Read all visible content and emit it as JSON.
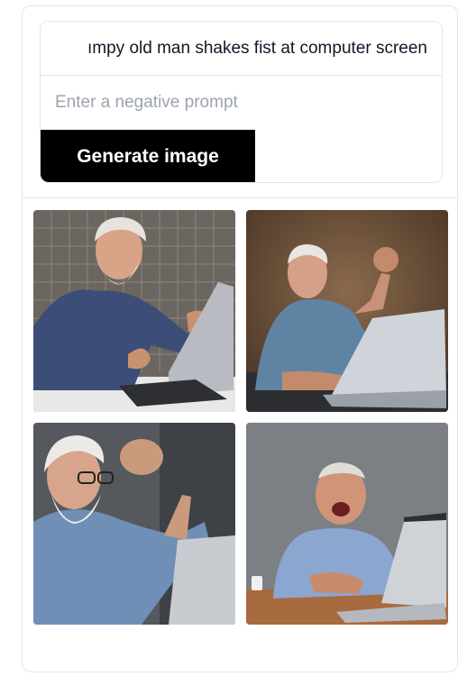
{
  "form": {
    "prompt_value": "Grumpy old man shakes fist at computer screen",
    "prompt_visible": "ımpy old man shakes fist at computer screen",
    "negative_placeholder": "Enter a negative prompt",
    "generate_label": "Generate image"
  },
  "gallery": {
    "images": [
      {
        "icon": "generated-image",
        "subject": "old-man-fist-laptop"
      },
      {
        "icon": "generated-image",
        "subject": "old-man-raised-fist-laptop"
      },
      {
        "icon": "generated-image",
        "subject": "old-man-glasses-fist"
      },
      {
        "icon": "generated-image",
        "subject": "old-man-shouting-laptop"
      }
    ]
  },
  "colors": {
    "button_bg": "#000000",
    "button_text": "#ffffff",
    "border": "#e5e7eb",
    "placeholder": "#9ca3af"
  }
}
